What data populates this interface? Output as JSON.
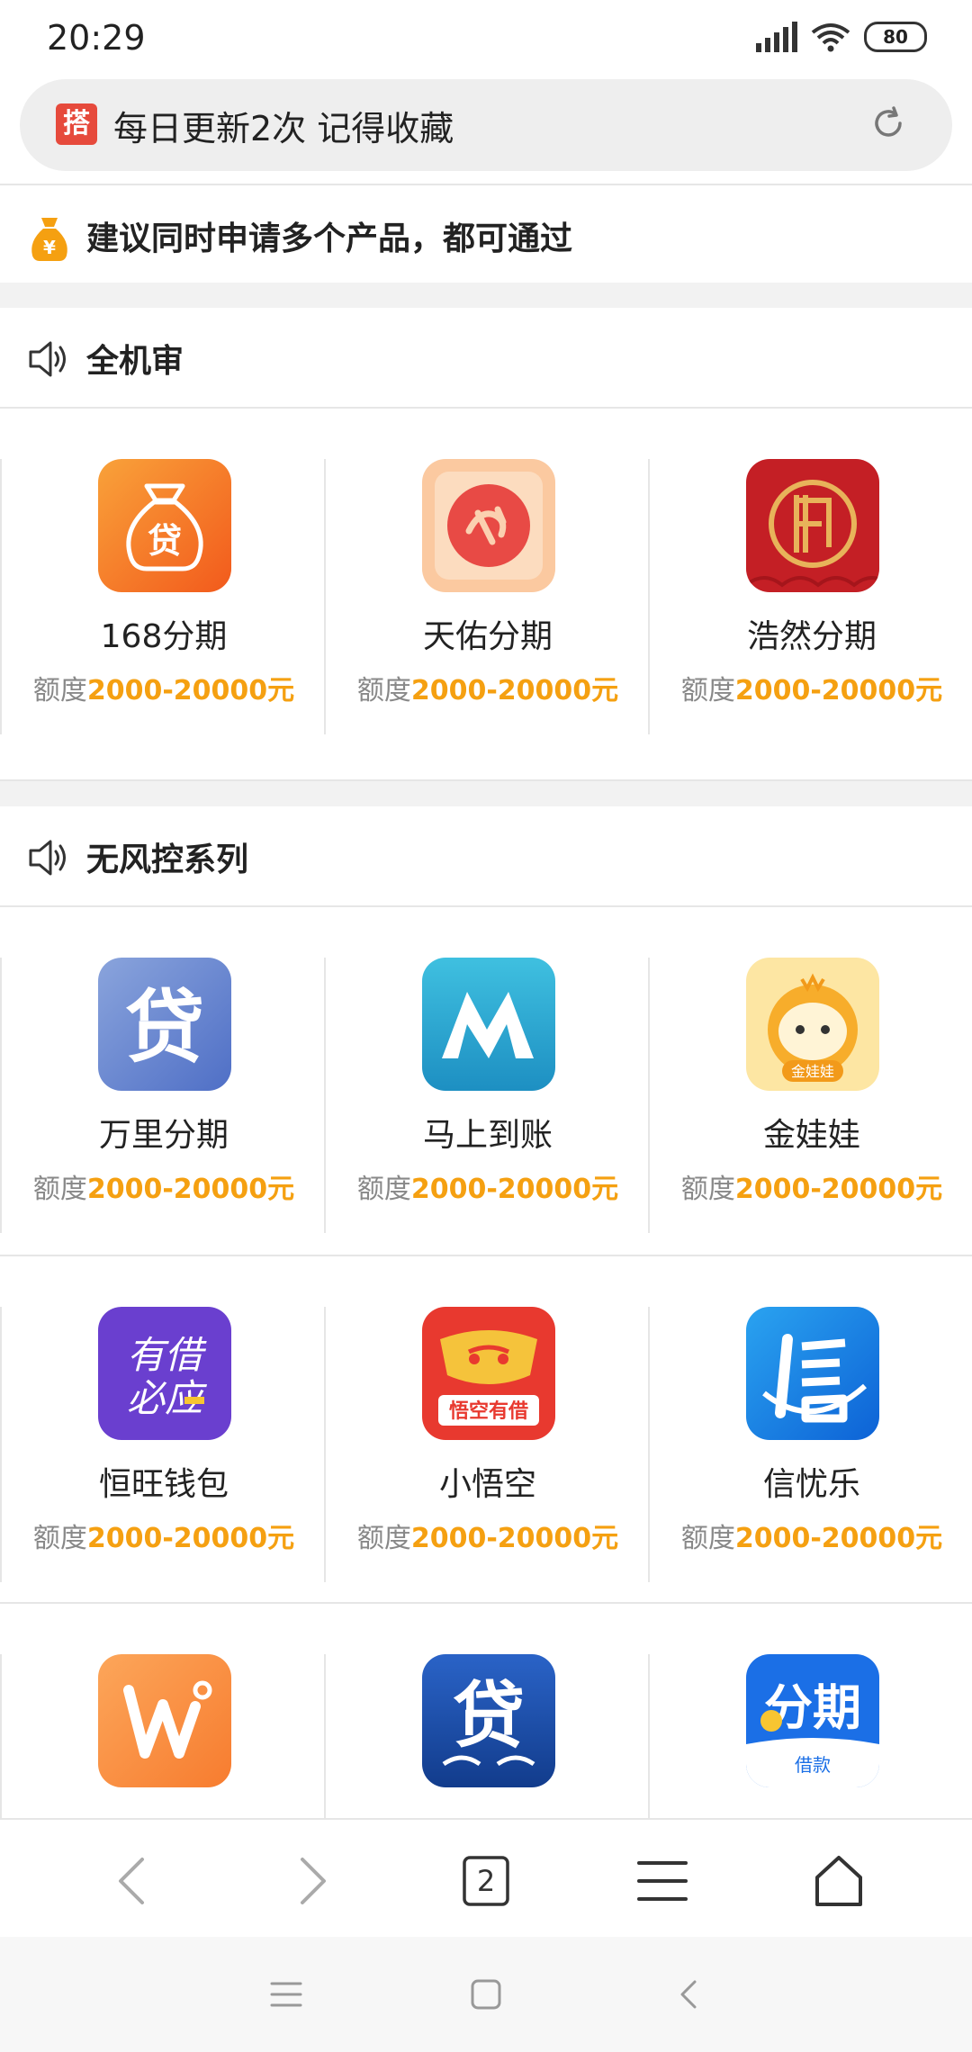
{
  "status_bar": {
    "time": "20:29",
    "battery": "80"
  },
  "address_bar": {
    "icon_char": "搭",
    "text": "每日更新2次 记得收藏"
  },
  "notice": {
    "text": "建议同时申请多个产品，都可通过"
  },
  "sections": [
    {
      "title": "全机审",
      "items": [
        {
          "name": "168分期",
          "label": "额度",
          "amount": "2000-20000元"
        },
        {
          "name": "天佑分期",
          "label": "额度",
          "amount": "2000-20000元"
        },
        {
          "name": "浩然分期",
          "label": "额度",
          "amount": "2000-20000元"
        }
      ]
    },
    {
      "title": "无风控系列",
      "items": [
        {
          "name": "万里分期",
          "label": "额度",
          "amount": "2000-20000元"
        },
        {
          "name": "马上到账",
          "label": "额度",
          "amount": "2000-20000元"
        },
        {
          "name": "金娃娃",
          "label": "额度",
          "amount": "2000-20000元"
        },
        {
          "name": "恒旺钱包",
          "label": "额度",
          "amount": "2000-20000元"
        },
        {
          "name": "小悟空",
          "label": "额度",
          "amount": "2000-20000元"
        },
        {
          "name": "信忧乐",
          "label": "额度",
          "amount": "2000-20000元"
        }
      ]
    }
  ],
  "logos": {
    "l168": "贷",
    "wanli": "贷",
    "jinwawa": "金娃娃",
    "hengwang_top": "有借",
    "hengwang_bottom": "必应",
    "xiaowukong": "悟空有借",
    "row3_c2": "贷",
    "row3_c3_top": "分期",
    "row3_c3_bottom": "借款"
  },
  "toolbar": {
    "tabs_count": "2"
  },
  "colors": {
    "accent": "#f5a011",
    "brand_red": "#e64a3c"
  }
}
